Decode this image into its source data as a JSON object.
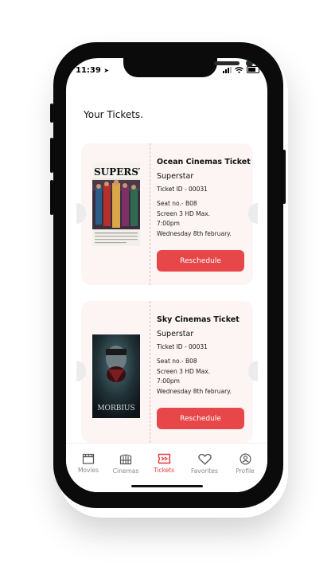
{
  "status_bar": {
    "time": "11:39"
  },
  "page": {
    "title": "Your Tickets."
  },
  "tickets": [
    {
      "cinema": "Ocean Cinemas Ticket",
      "movie": "Superstar",
      "ticket_id": "Ticket ID - 00031",
      "seat": "Seat no.- B08",
      "screen": "Screen 3 HD Max.",
      "time": "7:00pm",
      "date": "Wednesday 8th february.",
      "button": "Reschedule",
      "poster_title": "SUPERSTAR"
    },
    {
      "cinema": "Sky Cinemas Ticket",
      "movie": "Superstar",
      "ticket_id": "Ticket ID - 00031",
      "seat": "Seat no.- B08",
      "screen": "Screen 3 HD Max.",
      "time": "7:00pm",
      "date": "Wednesday 8th february.",
      "button": "Reschedule",
      "poster_title": "MORBIUS"
    }
  ],
  "tabbar": {
    "items": [
      {
        "label": "Movies",
        "icon": "clapperboard-icon",
        "active": false
      },
      {
        "label": "Cinemas",
        "icon": "cinema-icon",
        "active": false
      },
      {
        "label": "Tickets",
        "icon": "ticket-icon",
        "active": true
      },
      {
        "label": "Favorites",
        "icon": "heart-icon",
        "active": false
      },
      {
        "label": "Profile",
        "icon": "profile-icon",
        "active": false
      }
    ]
  },
  "colors": {
    "accent": "#E8474A",
    "ticket_bg": "#FDF5F4",
    "active_tab": "#E23B3B"
  }
}
